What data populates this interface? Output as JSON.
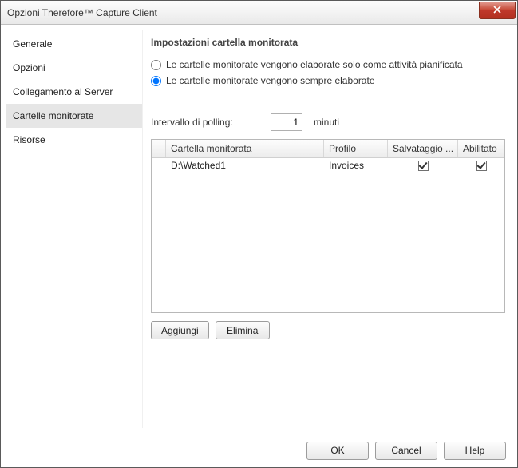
{
  "window": {
    "title": "Opzioni Therefore™ Capture Client"
  },
  "sidebar": {
    "items": [
      {
        "label": "Generale"
      },
      {
        "label": "Opzioni"
      },
      {
        "label": "Collegamento al Server"
      },
      {
        "label": "Cartelle monitorate"
      },
      {
        "label": "Risorse"
      }
    ],
    "selected_index": 3
  },
  "content": {
    "section_title": "Impostazioni cartella monitorata",
    "radio_scheduled": "Le cartelle monitorate vengono elaborate solo come attività pianificata",
    "radio_always": "Le cartelle monitorate vengono sempre elaborate",
    "radio_selected": "always",
    "polling_label": "Intervallo di polling:",
    "polling_value": "1",
    "polling_unit": "minuti",
    "table": {
      "headers": {
        "folder": "Cartella monitorata",
        "profile": "Profilo",
        "save": "Salvataggio ...",
        "enabled": "Abilitato"
      },
      "rows": [
        {
          "folder": "D:\\Watched1",
          "profile": "Invoices",
          "save": true,
          "enabled": true
        }
      ]
    },
    "buttons": {
      "add": "Aggiungi",
      "delete": "Elimina"
    }
  },
  "footer": {
    "ok": "OK",
    "cancel": "Cancel",
    "help": "Help"
  }
}
